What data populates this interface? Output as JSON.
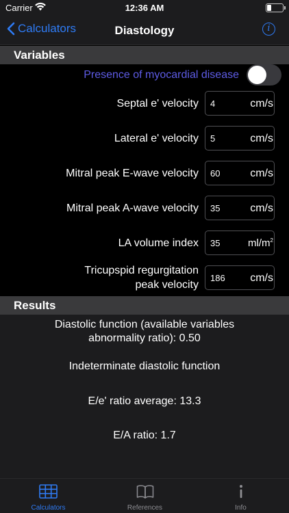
{
  "status_bar": {
    "carrier": "Carrier",
    "time": "12:36 AM"
  },
  "nav": {
    "back_label": "Calculators",
    "title": "Diastology",
    "info_glyph": "i"
  },
  "variables_section": {
    "header": "Variables",
    "toggle": {
      "label": "Presence of myocardial disease",
      "on": false
    },
    "rows": [
      {
        "label": "Septal e' velocity",
        "value": "4",
        "unit": "cm/s"
      },
      {
        "label": "Lateral e' velocity",
        "value": "5",
        "unit": "cm/s"
      },
      {
        "label": "Mitral peak E-wave velocity",
        "value": "60",
        "unit": "cm/s"
      },
      {
        "label": "Mitral peak A-wave velocity",
        "value": "35",
        "unit": "cm/s"
      },
      {
        "label": "LA volume index",
        "value": "35",
        "unit": "ml/m",
        "unit_sup": "2"
      },
      {
        "label_line1": "Tricupspid regurgitation",
        "label_line2": "peak velocity",
        "value": "186",
        "unit": "cm/s"
      }
    ]
  },
  "results_section": {
    "header": "Results",
    "diastolic_function_line1": "Diastolic function (available variables",
    "diastolic_function_line2": "abnormality ratio): 0.50",
    "interpretation": "Indeterminate diastolic function",
    "ee_ratio": "E/e' ratio average: 13.3",
    "ea_ratio": "E/A ratio: 1.7"
  },
  "tabs": [
    {
      "label": "Calculators",
      "icon": "table-icon",
      "active": true
    },
    {
      "label": "References",
      "icon": "book-icon",
      "active": false
    },
    {
      "label": "Info",
      "icon": "info-icon",
      "active": false
    }
  ],
  "colors": {
    "accent": "#2f7cf6",
    "toggle_label": "#5e5ce6",
    "section_header": "#3a3a3c",
    "bar_background": "#1c1c1e"
  }
}
